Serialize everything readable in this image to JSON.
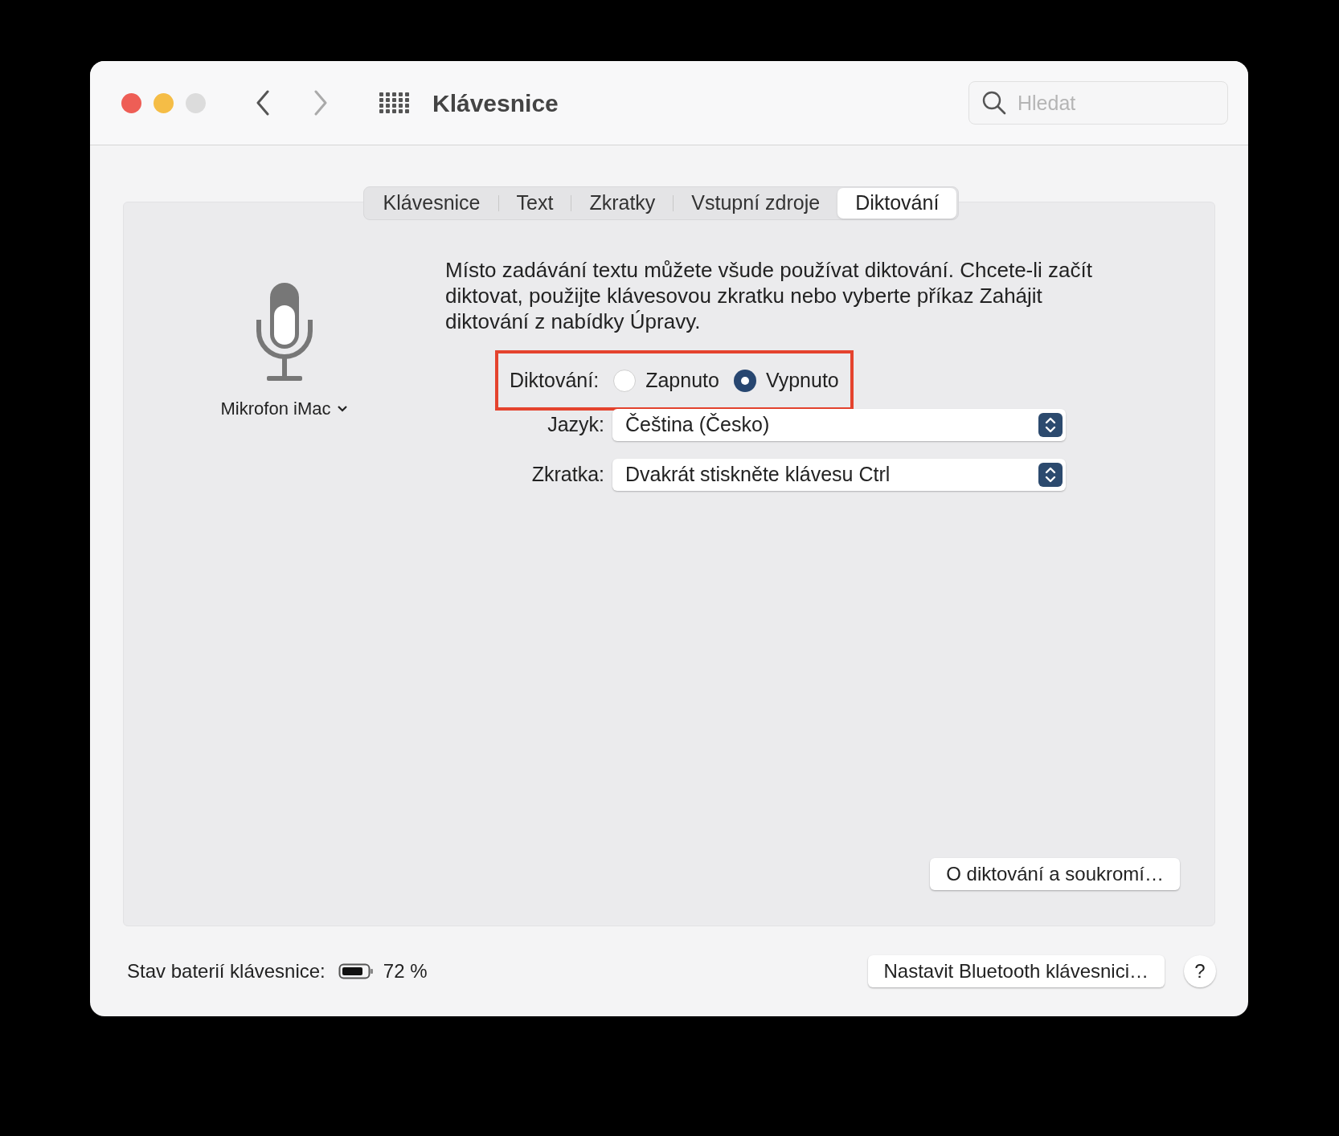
{
  "window": {
    "title": "Klávesnice"
  },
  "search": {
    "placeholder": "Hledat"
  },
  "tabs": [
    {
      "label": "Klávesnice",
      "selected": false
    },
    {
      "label": "Text",
      "selected": false
    },
    {
      "label": "Zkratky",
      "selected": false
    },
    {
      "label": "Vstupní zdroje",
      "selected": false
    },
    {
      "label": "Diktování",
      "selected": true
    }
  ],
  "microphone": {
    "label": "Mikrofon iMac"
  },
  "description": "Místo zadávání textu můžete všude používat diktování. Chcete-li začít diktovat, použijte klávesovou zkratku nebo vyberte příkaz Zahájit diktování z nabídky Úpravy.",
  "dictation": {
    "label": "Diktování:",
    "highlighted": true,
    "options": [
      {
        "label": "Zapnuto",
        "selected": false
      },
      {
        "label": "Vypnuto",
        "selected": true
      }
    ]
  },
  "popups": [
    {
      "label": "Jazyk:",
      "value": "Čeština (Česko)"
    },
    {
      "label": "Zkratka:",
      "value": "Dvakrát stiskněte klávesu Ctrl"
    }
  ],
  "privacy_button": "O diktování a soukromí…",
  "footer": {
    "battery_label": "Stav baterií klávesnice:",
    "battery_value": "72 %",
    "bluetooth_button": "Nastavit Bluetooth klávesnici…",
    "help_button": "?"
  }
}
